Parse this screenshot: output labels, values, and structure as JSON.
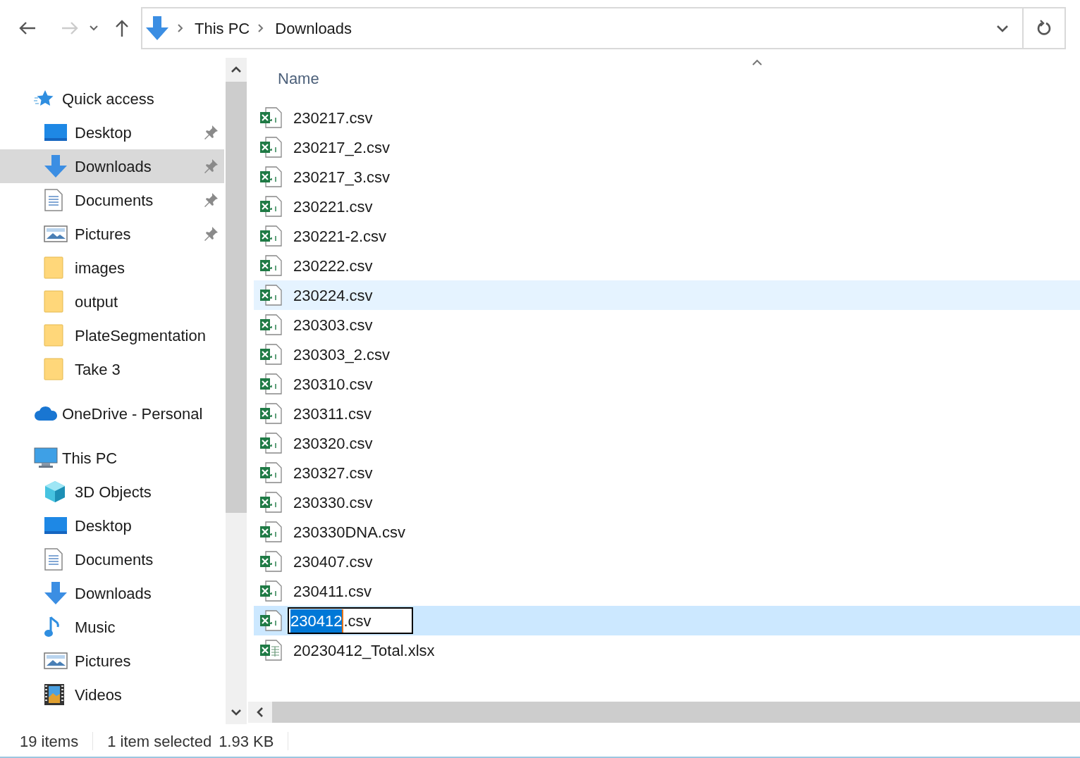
{
  "address_bar": {
    "path": [
      "This PC",
      "Downloads"
    ]
  },
  "navigation_pane": [
    {
      "label": "Quick access",
      "kind": "star",
      "selected": false,
      "children": [
        {
          "label": "Desktop",
          "kind": "desktop",
          "pinned": true,
          "selected": false
        },
        {
          "label": "Downloads",
          "kind": "download",
          "pinned": true,
          "selected": true
        },
        {
          "label": "Documents",
          "kind": "document",
          "pinned": true,
          "selected": false
        },
        {
          "label": "Pictures",
          "kind": "pictures",
          "pinned": true,
          "selected": false
        },
        {
          "label": "images",
          "kind": "folder",
          "pinned": false,
          "selected": false
        },
        {
          "label": "output",
          "kind": "folder",
          "pinned": false,
          "selected": false
        },
        {
          "label": "PlateSegmentation",
          "kind": "folder",
          "pinned": false,
          "selected": false
        },
        {
          "label": "Take 3",
          "kind": "folder",
          "pinned": false,
          "selected": false
        }
      ]
    },
    {
      "label": "OneDrive - Personal",
      "kind": "cloud",
      "selected": false
    },
    {
      "label": "This PC",
      "kind": "pc",
      "selected": false,
      "children": [
        {
          "label": "3D Objects",
          "kind": "cube",
          "pinned": false,
          "selected": false
        },
        {
          "label": "Desktop",
          "kind": "desktop",
          "pinned": false,
          "selected": false
        },
        {
          "label": "Documents",
          "kind": "document",
          "pinned": false,
          "selected": false
        },
        {
          "label": "Downloads",
          "kind": "download",
          "pinned": false,
          "selected": false
        },
        {
          "label": "Music",
          "kind": "music",
          "pinned": false,
          "selected": false
        },
        {
          "label": "Pictures",
          "kind": "pictures",
          "pinned": false,
          "selected": false
        },
        {
          "label": "Videos",
          "kind": "video",
          "pinned": false,
          "selected": false
        }
      ]
    }
  ],
  "file_list": {
    "columns": [
      "Name"
    ],
    "files": [
      {
        "name": "230217.csv",
        "kind": "csv",
        "hovered": false,
        "selected": false
      },
      {
        "name": "230217_2.csv",
        "kind": "csv",
        "hovered": false,
        "selected": false
      },
      {
        "name": "230217_3.csv",
        "kind": "csv",
        "hovered": false,
        "selected": false
      },
      {
        "name": "230221.csv",
        "kind": "csv",
        "hovered": false,
        "selected": false
      },
      {
        "name": "230221-2.csv",
        "kind": "csv",
        "hovered": false,
        "selected": false
      },
      {
        "name": "230222.csv",
        "kind": "csv",
        "hovered": false,
        "selected": false
      },
      {
        "name": "230224.csv",
        "kind": "csv",
        "hovered": true,
        "selected": false
      },
      {
        "name": "230303.csv",
        "kind": "csv",
        "hovered": false,
        "selected": false
      },
      {
        "name": "230303_2.csv",
        "kind": "csv",
        "hovered": false,
        "selected": false
      },
      {
        "name": "230310.csv",
        "kind": "csv",
        "hovered": false,
        "selected": false
      },
      {
        "name": "230311.csv",
        "kind": "csv",
        "hovered": false,
        "selected": false
      },
      {
        "name": "230320.csv",
        "kind": "csv",
        "hovered": false,
        "selected": false
      },
      {
        "name": "230327.csv",
        "kind": "csv",
        "hovered": false,
        "selected": false
      },
      {
        "name": "230330.csv",
        "kind": "csv",
        "hovered": false,
        "selected": false
      },
      {
        "name": "230330DNA.csv",
        "kind": "csv",
        "hovered": false,
        "selected": false
      },
      {
        "name": "230407.csv",
        "kind": "csv",
        "hovered": false,
        "selected": false
      },
      {
        "name": "230411.csv",
        "kind": "csv",
        "hovered": false,
        "selected": false
      },
      {
        "name_selected": "230412",
        "name_rest": ".csv",
        "kind": "csv",
        "hovered": false,
        "selected": true,
        "renaming": true
      },
      {
        "name": "20230412_Total.xlsx",
        "kind": "xlsx",
        "hovered": false,
        "selected": false
      }
    ]
  },
  "status_bar": {
    "item_count": "19 items",
    "selection": "1 item selected",
    "size": "1.93 KB"
  }
}
